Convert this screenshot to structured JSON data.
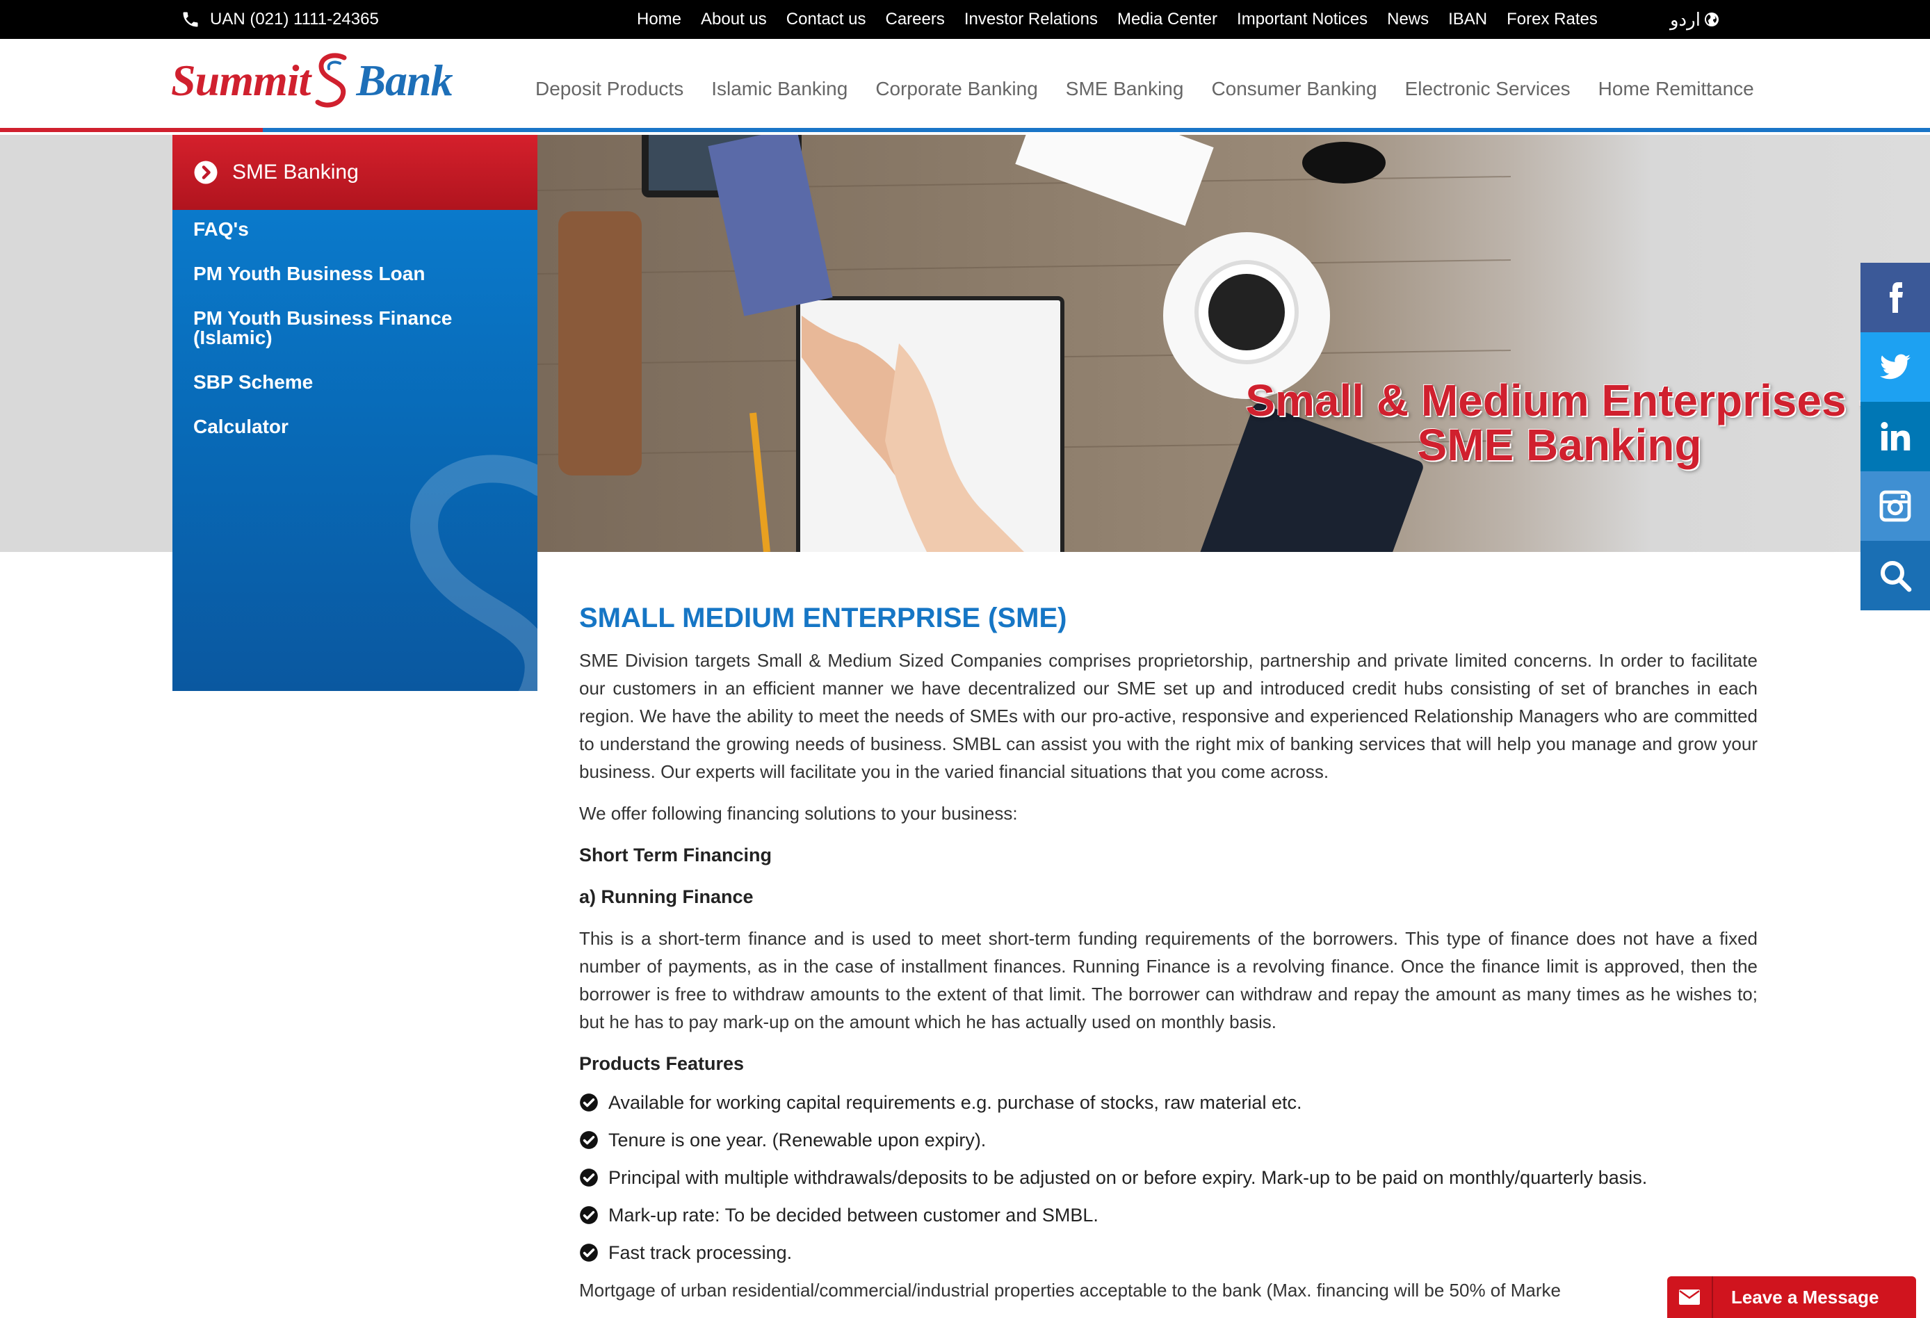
{
  "topbar": {
    "uan": "UAN (021) 1111-24365",
    "links": [
      "Home",
      "About us",
      "Contact us",
      "Careers",
      "Investor Relations",
      "Media Center",
      "Important Notices",
      "News",
      "IBAN",
      "Forex Rates"
    ],
    "language": "اردو"
  },
  "logo": {
    "part1": "Summit",
    "part2": "Bank"
  },
  "mainnav": [
    "Deposit Products",
    "Islamic Banking",
    "Corporate Banking",
    "SME Banking",
    "Consumer Banking",
    "Electronic Services",
    "Home Remittance"
  ],
  "sidebar": {
    "heading": "SME Banking",
    "items": [
      "FAQ's",
      "PM Youth Business Loan",
      "PM Youth Business Finance (Islamic)",
      "SBP Scheme",
      "Calculator"
    ]
  },
  "hero": {
    "line1": "Small & Medium Enterprises -",
    "line2": "SME Banking"
  },
  "social": [
    "facebook-icon",
    "twitter-icon",
    "linkedin-icon",
    "instagram-icon",
    "search-icon"
  ],
  "colors": {
    "brand_red": "#d0202e",
    "brand_blue": "#1676c5",
    "facebook": "#3b5998",
    "twitter": "#1da1f2",
    "linkedin": "#0077b5",
    "instagram": "#3f8fd2",
    "search": "#1a6fb4"
  },
  "content": {
    "title": "SMALL MEDIUM ENTERPRISE (SME)",
    "intro": "SME Division targets Small & Medium Sized Companies comprises proprietorship, partnership and private limited concerns. In order to facilitate our customers in an efficient manner we have decentralized our SME set up and introduced credit hubs consisting of set of branches in each region. We have the ability to meet the needs of SMEs with our pro-active, responsive and experienced Relationship Managers who are committed to understand the growing needs of business.  SMBL can assist you with the right mix of banking services that will help you manage and grow your business. Our experts will facilitate you in the varied financial situations that you come across.",
    "offer": "We offer following financing solutions to your business:",
    "short_term": "Short Term Financing",
    "running_finance": "a) Running Finance",
    "running_desc": "This is a short-term finance and is used to meet short-term funding requirements of the borrowers. This type of finance does not have a fixed number of payments, as in the case of installment finances. Running Finance is a revolving finance. Once the finance limit is approved, then the borrower is free to withdraw amounts to the extent of that limit. The borrower can withdraw and repay the amount as many times as he wishes to; but he has to pay mark-up on the amount which he has actually used on monthly basis.",
    "features_heading": "Products Features",
    "features": [
      "Available for working capital requirements e.g. purchase of stocks, raw material etc.",
      "Tenure is one year. (Renewable upon expiry).",
      "Principal with multiple withdrawals/deposits to be adjusted on or before expiry. Mark-up to be paid on monthly/quarterly basis.",
      "Mark-up rate: To be decided between customer and SMBL.",
      "Fast track processing."
    ],
    "mortgage": "Mortgage of urban residential/commercial/industrial properties acceptable to the bank (Max. financing will be 50% of Marke"
  },
  "chat": {
    "label": "Leave a Message"
  }
}
